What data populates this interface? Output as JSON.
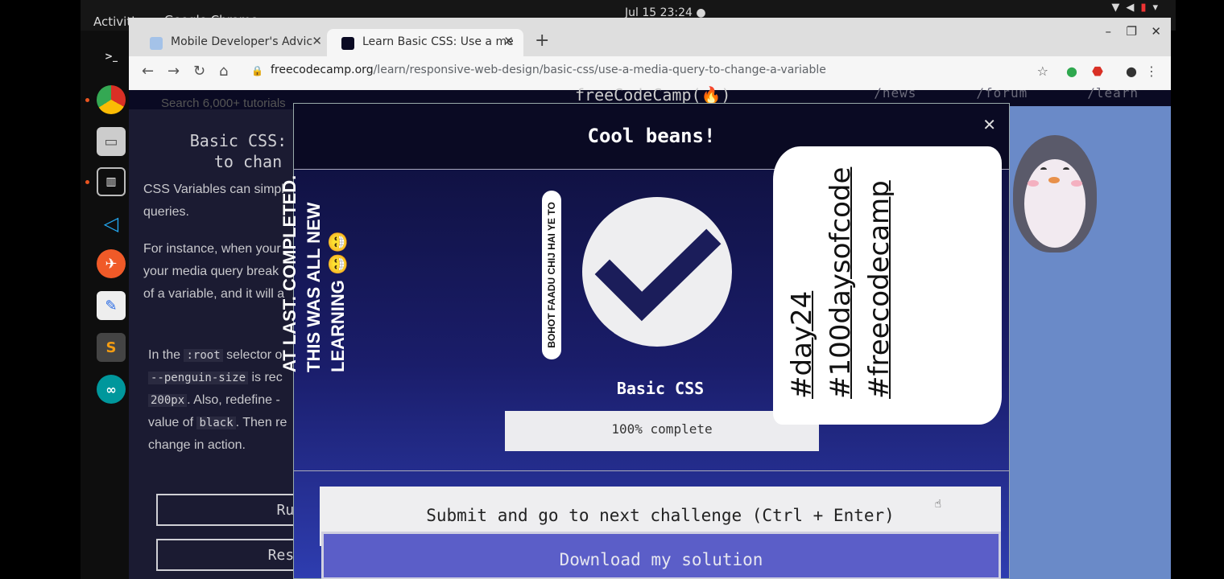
{
  "os": {
    "activities": "Activities",
    "app_name": "Google Chrome ▾",
    "clock": "Jul 15  23:24 ●"
  },
  "browser": {
    "tabs": [
      {
        "title": "Mobile Developer's Advic"
      },
      {
        "title": "Learn Basic CSS: Use a me"
      }
    ],
    "new_tab": "+",
    "url_host": "freecodecamp.org",
    "url_path": "/learn/responsive-web-design/basic-css/use-a-media-query-to-change-a-variable"
  },
  "fcc": {
    "search_placeholder": "Search 6,000+ tutorials",
    "logo": "freeCodeCamp(🔥)",
    "nav_links": [
      "/news",
      "/forum",
      "/learn"
    ],
    "lesson_title_l1": "Basic CSS: U",
    "lesson_title_l2": "to chan",
    "para1_l1": "CSS Variables can simpl",
    "para1_l2": "queries.",
    "para2_l1": "For instance, when your",
    "para2_l2": "your media query break",
    "para2_l3": "of a variable, and it will a",
    "para3_l1_a": "In the ",
    "para3_l1_code": ":root",
    "para3_l1_b": " selector o",
    "para3_l2_code": "--penguin-size",
    "para3_l2_b": " is rec",
    "para3_l3_code": "200px",
    "para3_l3_b": ". Also, redefine  -",
    "para3_l4_a": "value of ",
    "para3_l4_code": "black",
    "para3_l4_b": ". Then re",
    "para3_l5": "change in action.",
    "run_button": "Run",
    "reset_button": "Rese"
  },
  "modal": {
    "title": "Cool beans!",
    "course": "Basic CSS",
    "progress_percent": 100,
    "progress_label": "100% complete",
    "submit_button": "Submit and go to next challenge (Ctrl + Enter)",
    "download_button": "Download my solution"
  },
  "overlay": {
    "main_l1": "AT LAST. COMPLETED.",
    "main_l2": "THIS WAS ALL NEW",
    "main_l3": "LEARNING 😁😁",
    "small": "BOHOT FAADU CHIJ HAI YE TO",
    "tag1": "#day24",
    "tag2": "#100daysofcode",
    "tag3": "#freecodecamp"
  },
  "colors": {
    "modal_header": "#0a0a23",
    "modal_gradient_bottom": "#2e3db0",
    "check_mark": "#1b1d5a"
  }
}
